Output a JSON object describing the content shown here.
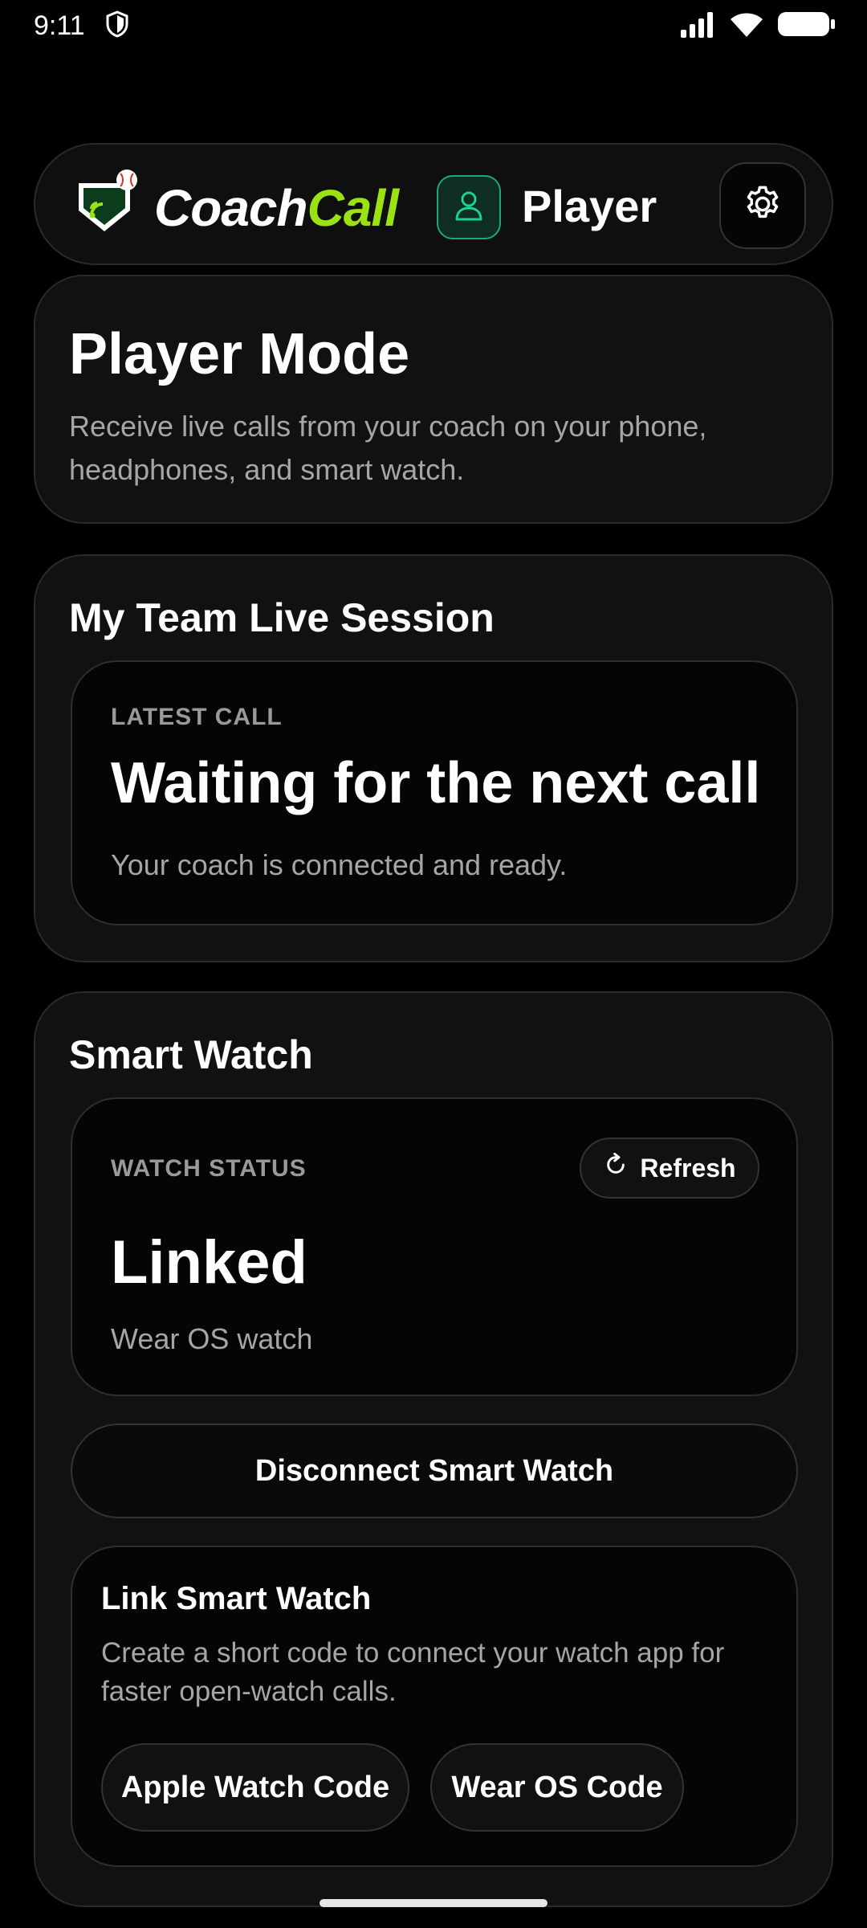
{
  "status_bar": {
    "time": "9:11"
  },
  "header": {
    "logo_part1": "Coach",
    "logo_part2": "Call",
    "role_label": "Player"
  },
  "mode_card": {
    "title": "Player Mode",
    "description": "Receive live calls from your coach on your phone, headphones, and smart watch."
  },
  "session_card": {
    "title": "My Team Live Session",
    "latest_call_label": "LATEST CALL",
    "latest_call_title": "Waiting for the next call",
    "latest_call_subtitle": "Your coach is connected and ready."
  },
  "watch_card": {
    "title": "Smart Watch",
    "status_label": "WATCH STATUS",
    "refresh_label": "Refresh",
    "status_value": "Linked",
    "watch_type": "Wear OS watch",
    "disconnect_label": "Disconnect Smart Watch",
    "link_title": "Link Smart Watch",
    "link_description": "Create a short code to connect your watch app for faster open-watch calls.",
    "apple_code_label": "Apple Watch Code",
    "wear_code_label": "Wear OS Code"
  },
  "colors": {
    "brand_green": "#9be214",
    "accent_teal": "#1fa876",
    "background": "#000000",
    "card": "#111111"
  }
}
